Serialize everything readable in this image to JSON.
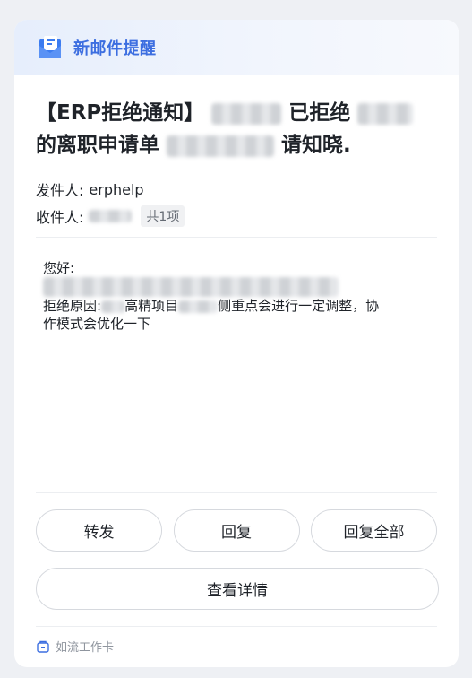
{
  "card": {
    "header_title": "新邮件提醒",
    "subject_part1": "【ERP拒绝通知】",
    "subject_part2": "已拒绝",
    "subject_part3": "的离职申请单",
    "subject_part4": "请知晓.",
    "sender_label": "发件人:",
    "sender_value": "erphelp",
    "recipient_label": "收件人:",
    "recipient_count": "共1项",
    "greeting": "您好:",
    "reason_label": "拒绝原因:",
    "reason_text_a": "高精项目",
    "reason_text_b": "侧重点会进行一定调整，协",
    "reason_text_c": "作模式会优化一下",
    "forward_label": "转发",
    "reply_label": "回复",
    "reply_all_label": "回复全部",
    "view_details_label": "查看详情",
    "footer_label": "如流工作卡"
  },
  "colors": {
    "accent": "#3c6ee0",
    "muted": "#8f959e"
  },
  "icons": {
    "header": "mail-icon",
    "footer": "work-card-icon"
  }
}
